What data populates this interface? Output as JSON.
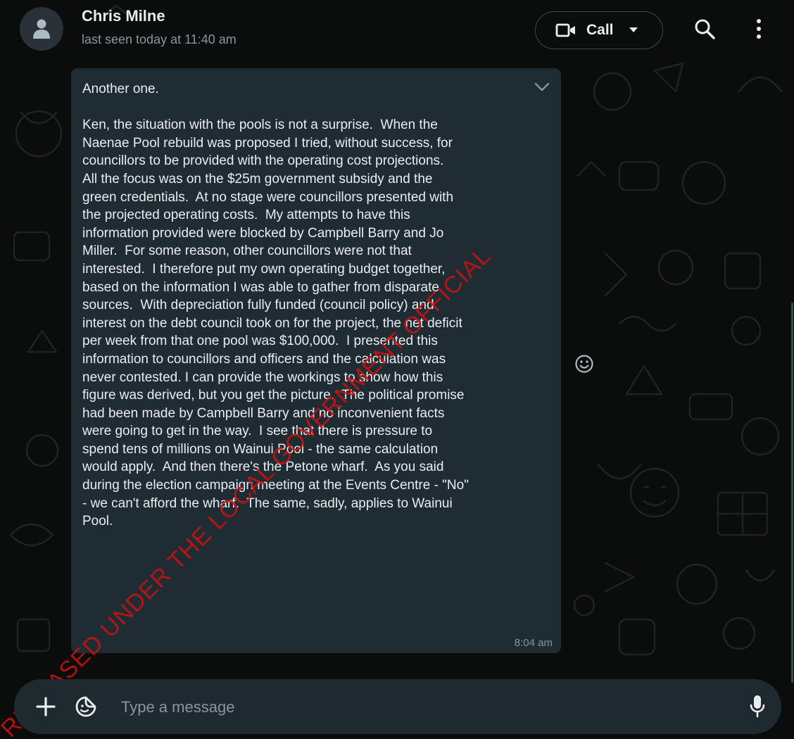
{
  "header": {
    "contact_name": "Chris Milne",
    "last_seen": "last seen today at 11:40 am",
    "call_label": "Call"
  },
  "message": {
    "text": "Another one.\n\nKen, the situation with the pools is not a surprise.  When the\nNaenae Pool rebuild was proposed I tried, without success, for\ncouncillors to be provided with the operating cost projections.\nAll the focus was on the $25m government subsidy and the\ngreen credentials.  At no stage were councillors presented with\nthe projected operating costs.  My attempts to have this\ninformation provided were blocked by Campbell Barry and Jo\nMiller.  For some reason, other councillors were not that\ninterested.  I therefore put my own operating budget together,\nbased on the information I was able to gather from disparate\nsources.  With depreciation fully funded (council policy) and\ninterest on the debt council took on for the project, the net deficit\nper week from that one pool was $100,000.  I presented this\ninformation to councillors and officers and the calculation was\nnever contested. I can provide the workings to show how this\nfigure was derived, but you get the picture.  The political promise\nhad been made by Campbell Barry and no inconvenient facts\nwere going to get in the way.  I see that there is pressure to\nspend tens of millions on Wainui Pool - the same calculation\nwould apply.  And then there's the Petone wharf.  As you said\nduring the election campaign meeting at the Events Centre - \"No\"\n- we can't afford the wharf.  The same, sadly, applies to Wainui\nPool.",
    "time": "8:04 am"
  },
  "watermark": "RELEASED UNDER THE LOCAL GOVERNMENT OFFICIAL",
  "composer": {
    "placeholder": "Type a message"
  },
  "icons": {
    "avatar": "person-icon",
    "video": "video-camera-icon",
    "dropdown": "caret-down-icon",
    "search": "search-icon",
    "menu": "kebab-menu-icon",
    "message_menu": "chevron-down-icon",
    "react": "smiley-icon",
    "attach": "plus-icon",
    "sticker": "sticker-icon",
    "voice": "microphone-icon"
  },
  "colors": {
    "background": "#0b0c0c",
    "bubble": "#202c33",
    "primary_text": "#e9edef",
    "secondary_text": "#8696a0",
    "composer": "#1f2a30",
    "watermark": "#cd1212"
  }
}
